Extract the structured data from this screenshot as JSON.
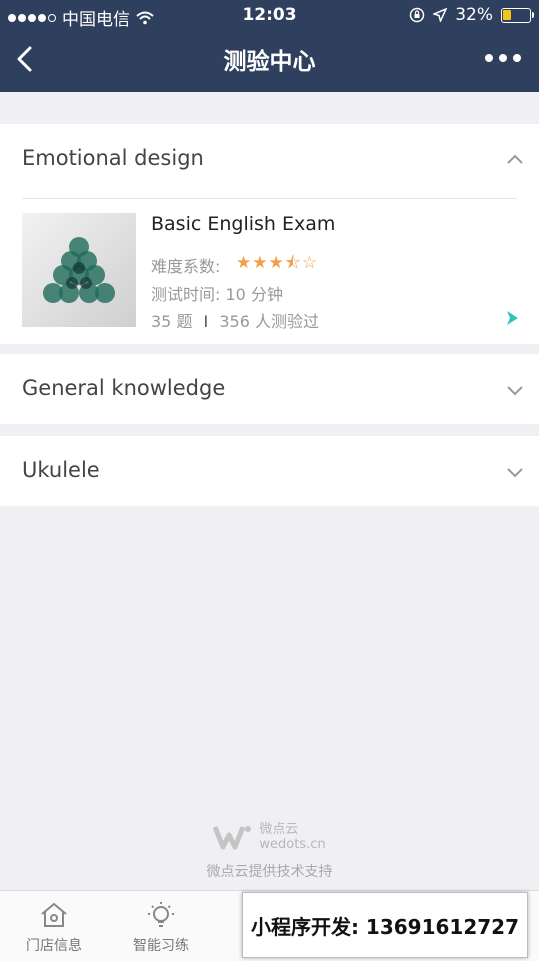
{
  "status_bar": {
    "carrier": "中国电信",
    "time": "12:03",
    "battery": "32%",
    "battery_level": 0.32
  },
  "nav": {
    "title": "测验中心"
  },
  "sections": [
    {
      "title": "Emotional design",
      "expanded": true,
      "exam": {
        "title": "Basic English Exam",
        "difficulty_label": "难度系数:",
        "difficulty_rating": 3.5,
        "difficulty_max": 5,
        "stars": "★★★⯪☆",
        "time_label": "测试时间:",
        "time_value": "10 分钟",
        "questions": "35 题",
        "separator": "I",
        "participants": "356 人测验过"
      }
    },
    {
      "title": "General knowledge",
      "expanded": false
    },
    {
      "title": "Ukulele",
      "expanded": false
    }
  ],
  "footer": {
    "brand_cn": "微点云",
    "brand_url": "wedots.cn",
    "support": "微点云提供技术支持"
  },
  "tabbar": {
    "tabs": [
      {
        "label": "门店信息",
        "icon": "home-icon"
      },
      {
        "label": "智能习练",
        "icon": "lightbulb-icon"
      }
    ]
  },
  "promo": {
    "text": "小程序开发: 13691612727"
  },
  "colors": {
    "nav_bg": "#2f3f5e",
    "star": "#f0a04b",
    "accent_arrow": "#2ec4b6",
    "page_bg": "#efeff4"
  }
}
